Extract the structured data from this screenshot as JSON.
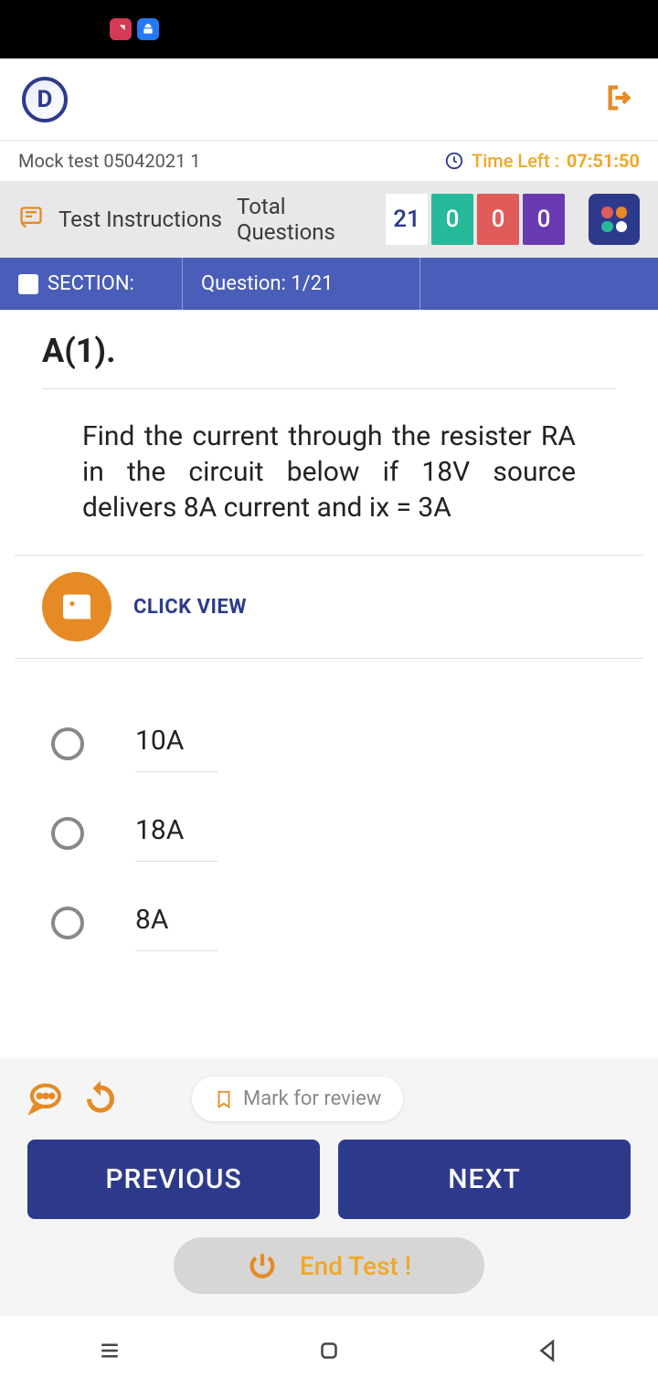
{
  "statusBar": {},
  "header": {
    "logoLetter": "D"
  },
  "infoBar": {
    "testName": "Mock test 05042021 1",
    "timeLeftLabel": "Time Left :",
    "timeValue": "07:51:50"
  },
  "instructionsBar": {
    "instructionsLabel": "Test Instructions",
    "totalQuestionsLabel": "Total Questions",
    "counts": {
      "total": "21",
      "answered": "0",
      "unanswered": "0",
      "marked": "0"
    }
  },
  "sectionBar": {
    "sectionLabel": "SECTION:",
    "questionLabel": "Question: 1/21"
  },
  "question": {
    "number": "A(1).",
    "text": "Find the current through the resister RA in the circuit below if 18V source delivers 8A current and ix = 3A",
    "clickView": "CLICK VIEW",
    "options": [
      "10A",
      "18A",
      "8A"
    ]
  },
  "controls": {
    "markForReview": "Mark for review",
    "previous": "PREVIOUS",
    "next": "NEXT",
    "endTest": "End Test !"
  }
}
